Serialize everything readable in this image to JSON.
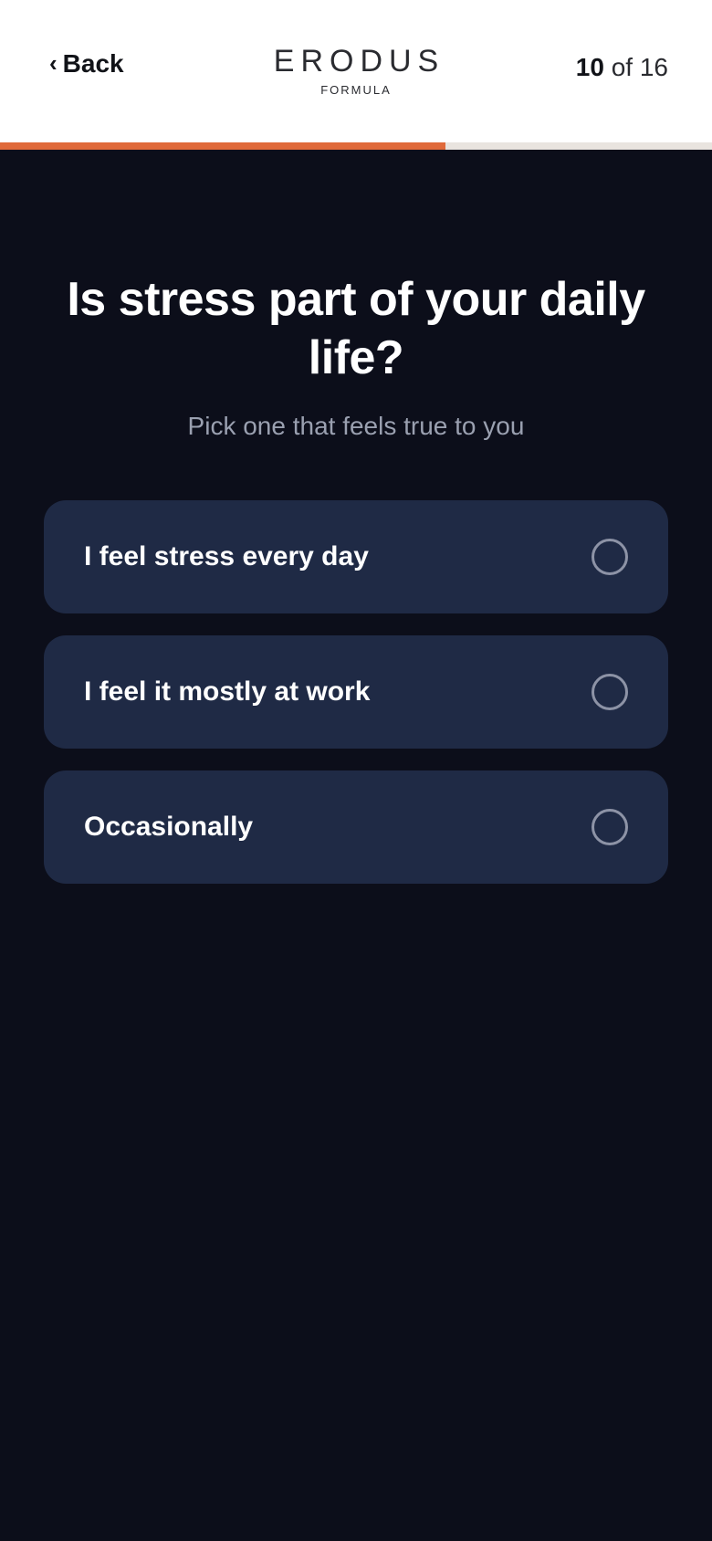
{
  "header": {
    "back_label": "Back",
    "back_icon": "chevron-left-icon",
    "logo_word": "ERODUS",
    "logo_sub": "FORMULA",
    "step_current": "10",
    "step_total_text": "of 16"
  },
  "progress": {
    "current": 10,
    "total": 16,
    "fill_color": "#e06a3b",
    "track_color": "#e9e4df"
  },
  "question": {
    "title": "Is stress part of your daily life?",
    "subtitle": "Pick one that feels true to you"
  },
  "options": [
    {
      "label": "I feel stress every day",
      "selected": false
    },
    {
      "label": "I feel it mostly at work",
      "selected": false
    },
    {
      "label": "Occasionally",
      "selected": false
    }
  ],
  "colors": {
    "background": "#0c0e1a",
    "option_bg": "#1f2a45",
    "accent": "#e06a3b"
  }
}
